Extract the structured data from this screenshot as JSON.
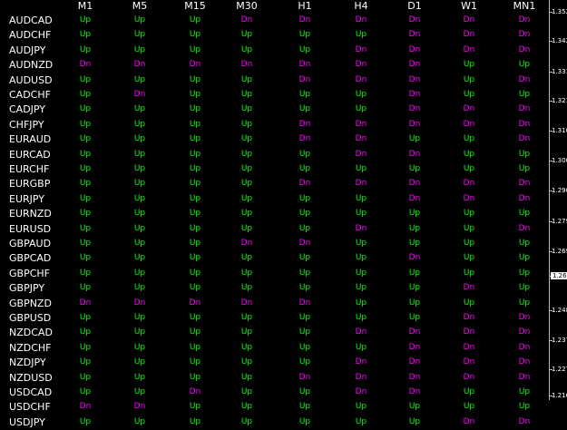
{
  "columns": [
    "M1",
    "M5",
    "M15",
    "M30",
    "H1",
    "H4",
    "D1",
    "W1",
    "MN1"
  ],
  "rows": [
    {
      "symbol": "AUDCAD",
      "values": [
        "Up",
        "Up",
        "Up",
        "Dn",
        "Dn",
        "Dn",
        "Dn",
        "Dn",
        "Dn"
      ]
    },
    {
      "symbol": "AUDCHF",
      "values": [
        "Up",
        "Up",
        "Up",
        "Up",
        "Up",
        "Up",
        "Dn",
        "Dn",
        "Dn"
      ]
    },
    {
      "symbol": "AUDJPY",
      "values": [
        "Up",
        "Up",
        "Up",
        "Up",
        "Up",
        "Dn",
        "Dn",
        "Dn",
        "Dn"
      ]
    },
    {
      "symbol": "AUDNZD",
      "values": [
        "Dn",
        "Dn",
        "Dn",
        "Dn",
        "Dn",
        "Dn",
        "Dn",
        "Up",
        "Up"
      ]
    },
    {
      "symbol": "AUDUSD",
      "values": [
        "Up",
        "Up",
        "Up",
        "Up",
        "Dn",
        "Dn",
        "Dn",
        "Up",
        "Dn"
      ]
    },
    {
      "symbol": "CADCHF",
      "values": [
        "Up",
        "Dn",
        "Up",
        "Up",
        "Up",
        "Up",
        "Dn",
        "Up",
        "Up"
      ]
    },
    {
      "symbol": "CADJPY",
      "values": [
        "Up",
        "Up",
        "Up",
        "Up",
        "Up",
        "Up",
        "Dn",
        "Dn",
        "Dn"
      ]
    },
    {
      "symbol": "CHFJPY",
      "values": [
        "Up",
        "Up",
        "Up",
        "Up",
        "Dn",
        "Dn",
        "Dn",
        "Dn",
        "Dn"
      ]
    },
    {
      "symbol": "EURAUD",
      "values": [
        "Up",
        "Up",
        "Up",
        "Up",
        "Dn",
        "Dn",
        "Up",
        "Up",
        "Dn"
      ]
    },
    {
      "symbol": "EURCAD",
      "values": [
        "Up",
        "Up",
        "Up",
        "Up",
        "Up",
        "Dn",
        "Dn",
        "Up",
        "Up"
      ]
    },
    {
      "symbol": "EURCHF",
      "values": [
        "Up",
        "Up",
        "Up",
        "Up",
        "Up",
        "Up",
        "Up",
        "Up",
        "Up"
      ]
    },
    {
      "symbol": "EURGBP",
      "values": [
        "Up",
        "Up",
        "Up",
        "Up",
        "Dn",
        "Dn",
        "Dn",
        "Dn",
        "Dn"
      ]
    },
    {
      "symbol": "EURJPY",
      "values": [
        "Up",
        "Up",
        "Up",
        "Up",
        "Up",
        "Up",
        "Dn",
        "Dn",
        "Dn"
      ]
    },
    {
      "symbol": "EURNZD",
      "values": [
        "Up",
        "Up",
        "Up",
        "Up",
        "Up",
        "Up",
        "Up",
        "Up",
        "Up"
      ]
    },
    {
      "symbol": "EURUSD",
      "values": [
        "Up",
        "Up",
        "Up",
        "Up",
        "Up",
        "Dn",
        "Up",
        "Up",
        "Dn"
      ]
    },
    {
      "symbol": "GBPAUD",
      "values": [
        "Up",
        "Up",
        "Up",
        "Dn",
        "Dn",
        "Up",
        "Up",
        "Up",
        "Up"
      ]
    },
    {
      "symbol": "GBPCAD",
      "values": [
        "Up",
        "Up",
        "Up",
        "Up",
        "Up",
        "Up",
        "Dn",
        "Up",
        "Up"
      ]
    },
    {
      "symbol": "GBPCHF",
      "values": [
        "Up",
        "Up",
        "Up",
        "Up",
        "Up",
        "Up",
        "Up",
        "Up",
        "Up"
      ]
    },
    {
      "symbol": "GBPJPY",
      "values": [
        "Up",
        "Up",
        "Up",
        "Up",
        "Up",
        "Up",
        "Up",
        "Dn",
        "Up"
      ]
    },
    {
      "symbol": "GBPNZD",
      "values": [
        "Dn",
        "Dn",
        "Dn",
        "Dn",
        "Dn",
        "Up",
        "Up",
        "Up",
        "Up"
      ]
    },
    {
      "symbol": "GBPUSD",
      "values": [
        "Up",
        "Up",
        "Up",
        "Up",
        "Up",
        "Up",
        "Up",
        "Dn",
        "Dn"
      ]
    },
    {
      "symbol": "NZDCAD",
      "values": [
        "Up",
        "Up",
        "Up",
        "Up",
        "Up",
        "Dn",
        "Dn",
        "Dn",
        "Dn"
      ]
    },
    {
      "symbol": "NZDCHF",
      "values": [
        "Up",
        "Up",
        "Up",
        "Up",
        "Up",
        "Up",
        "Dn",
        "Dn",
        "Dn"
      ]
    },
    {
      "symbol": "NZDJPY",
      "values": [
        "Up",
        "Up",
        "Up",
        "Up",
        "Up",
        "Dn",
        "Dn",
        "Dn",
        "Dn"
      ]
    },
    {
      "symbol": "NZDUSD",
      "values": [
        "Up",
        "Up",
        "Up",
        "Up",
        "Dn",
        "Dn",
        "Dn",
        "Dn",
        "Dn"
      ]
    },
    {
      "symbol": "USDCAD",
      "values": [
        "Up",
        "Up",
        "Dn",
        "Up",
        "Up",
        "Dn",
        "Dn",
        "Up",
        "Up"
      ]
    },
    {
      "symbol": "USDCHF",
      "values": [
        "Dn",
        "Dn",
        "Up",
        "Up",
        "Up",
        "Up",
        "Up",
        "Up",
        "Up"
      ]
    },
    {
      "symbol": "USDJPY",
      "values": [
        "Up",
        "Up",
        "Up",
        "Up",
        "Up",
        "Up",
        "Up",
        "Dn",
        "Dn"
      ]
    }
  ],
  "price_axis": {
    "labels": [
      "1.352",
      "1.342",
      "1.331",
      "1.321",
      "1.310",
      "1.300",
      "1.290",
      "1.279",
      "1.269",
      "1.260",
      "1.248",
      "1.237",
      "1.227",
      "1.216"
    ],
    "current_price": "1.260"
  },
  "colors": {
    "up": "#00ff00",
    "dn": "#ff00ff",
    "text": "#ffffff",
    "background": "#000000"
  }
}
